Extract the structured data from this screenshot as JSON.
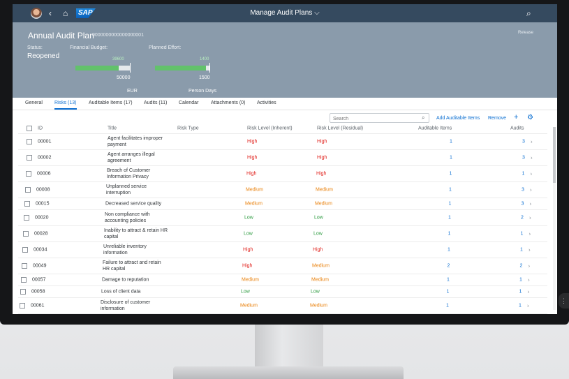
{
  "shell": {
    "title": "Manage Audit Plans",
    "logo_text": "SAP",
    "icons": [
      "avatar",
      "back-icon",
      "home-icon",
      "chevron-down-icon",
      "search-icon"
    ]
  },
  "header": {
    "title": "Annual Audit Plan",
    "id": "0000000000000000001",
    "release_label": "Release",
    "status_label": "Status:",
    "status_value": "Reopened",
    "budget_label": "Financial Budget:",
    "budget_actual": "39600",
    "budget_max": "50000",
    "budget_unit": "EUR",
    "budget_fraction": 0.79,
    "effort_label": "Planned Effort:",
    "effort_actual": "1400",
    "effort_max": "1500",
    "effort_unit": "Person Days",
    "effort_fraction": 0.93
  },
  "tabs": [
    {
      "label": "General",
      "active": false
    },
    {
      "label": "Risks (13)",
      "active": true
    },
    {
      "label": "Auditable Items (17)",
      "active": false
    },
    {
      "label": "Audits (11)",
      "active": false
    },
    {
      "label": "Calendar",
      "active": false
    },
    {
      "label": "Attachments (0)",
      "active": false
    },
    {
      "label": "Activities",
      "active": false
    }
  ],
  "toolbar": {
    "search_placeholder": "Search",
    "add_label": "Add Auditable Items",
    "remove_label": "Remove"
  },
  "columns": {
    "id": "ID",
    "title": "Title",
    "risk_type": "Risk Type",
    "inherent": "Risk Level (Inherent)",
    "residual": "Risk Level (Residual)",
    "auditable_items": "Auditable Items",
    "audits": "Audits"
  },
  "rows": [
    {
      "id": "00001",
      "title": "Agent facilitates improper payment",
      "risk_type": "",
      "inherent": "High",
      "residual": "High",
      "items": "1",
      "audits": "3"
    },
    {
      "id": "00002",
      "title": "Agent arranges illegal agreement",
      "risk_type": "",
      "inherent": "High",
      "residual": "High",
      "items": "1",
      "audits": "3"
    },
    {
      "id": "00006",
      "title": "Breach of Customer Information Privacy",
      "risk_type": "",
      "inherent": "High",
      "residual": "High",
      "items": "1",
      "audits": "1"
    },
    {
      "id": "00008",
      "title": "Unplanned service interruption",
      "risk_type": "",
      "inherent": "Medium",
      "residual": "Medium",
      "items": "1",
      "audits": "3"
    },
    {
      "id": "00015",
      "title": "Decreased service quality",
      "risk_type": "",
      "inherent": "Medium",
      "residual": "Medium",
      "items": "1",
      "audits": "3"
    },
    {
      "id": "00020",
      "title": "Non compliance with accounting policies",
      "risk_type": "",
      "inherent": "Low",
      "residual": "Low",
      "items": "1",
      "audits": "2"
    },
    {
      "id": "00028",
      "title": "Inability to attract & retain HR capital",
      "risk_type": "",
      "inherent": "Low",
      "residual": "Low",
      "items": "1",
      "audits": "1"
    },
    {
      "id": "00034",
      "title": "Unreliable inventory information",
      "risk_type": "",
      "inherent": "High",
      "residual": "High",
      "items": "1",
      "audits": "1"
    },
    {
      "id": "00049",
      "title": "Failure to attract and retain HR capital",
      "risk_type": "",
      "inherent": "High",
      "residual": "Medium",
      "items": "2",
      "audits": "2"
    },
    {
      "id": "00057",
      "title": "Damage to reputation",
      "risk_type": "",
      "inherent": "Medium",
      "residual": "Medium",
      "items": "1",
      "audits": "1"
    },
    {
      "id": "00058",
      "title": "Loss of client data",
      "risk_type": "",
      "inherent": "Low",
      "residual": "Low",
      "items": "1",
      "audits": "1"
    },
    {
      "id": "00061",
      "title": "Disclosure of customer information",
      "risk_type": "",
      "inherent": "Medium",
      "residual": "Medium",
      "items": "1",
      "audits": "1"
    }
  ]
}
